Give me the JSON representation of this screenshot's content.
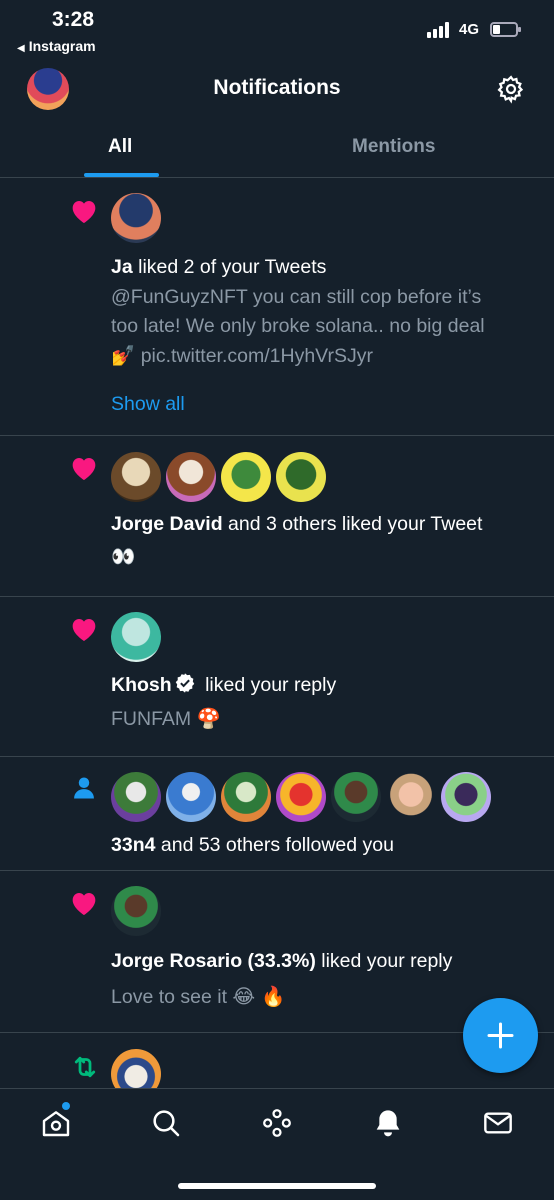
{
  "status_bar": {
    "time": "3:28",
    "back_label": "Instagram",
    "network": "4G"
  },
  "header": {
    "title": "Notifications",
    "settings_icon": "gear-icon"
  },
  "tabs": [
    {
      "label": "All",
      "active": true
    },
    {
      "label": "Mentions",
      "active": false
    }
  ],
  "notifications": [
    {
      "type": "like",
      "icon": "heart-icon",
      "name": "Ja",
      "action": "liked 2 of your Tweets",
      "sub_line1": "@FunGuyzNFT you can still cop before it’s",
      "sub_line2": "too late! We only broke solana.. no big deal",
      "sub_line3_emoji": "💅",
      "sub_line3_text": "pic.twitter.com/1HyhVrSJyr",
      "link": "Show all"
    },
    {
      "type": "like",
      "icon": "heart-icon",
      "name": "Jorge David",
      "action": "and 3 others liked your Tweet",
      "sub": "👀"
    },
    {
      "type": "like",
      "icon": "heart-icon",
      "name": "Khosh",
      "verified": true,
      "action": "liked your reply",
      "sub_text": "FUNFAM",
      "sub_emoji": "🍄"
    },
    {
      "type": "follow",
      "icon": "person-icon",
      "name": "33n4",
      "action": "and 53 others followed you"
    },
    {
      "type": "like",
      "icon": "heart-icon",
      "name": "Jorge Rosario (33.3%)",
      "action": "liked your reply",
      "sub_text": "Love to see it",
      "sub_emoji": "😂 🔥"
    },
    {
      "type": "retweet",
      "icon": "retweet-icon"
    }
  ],
  "colors": {
    "background": "#15202b",
    "accent": "#1d9bf0",
    "like": "#f91880",
    "retweet": "#00ba7c",
    "secondary_text": "#8b98a5",
    "divider": "#38444d"
  },
  "bottom_nav": [
    "home-icon",
    "search-icon",
    "spaces-icon",
    "notifications-bell-icon",
    "messages-icon"
  ]
}
